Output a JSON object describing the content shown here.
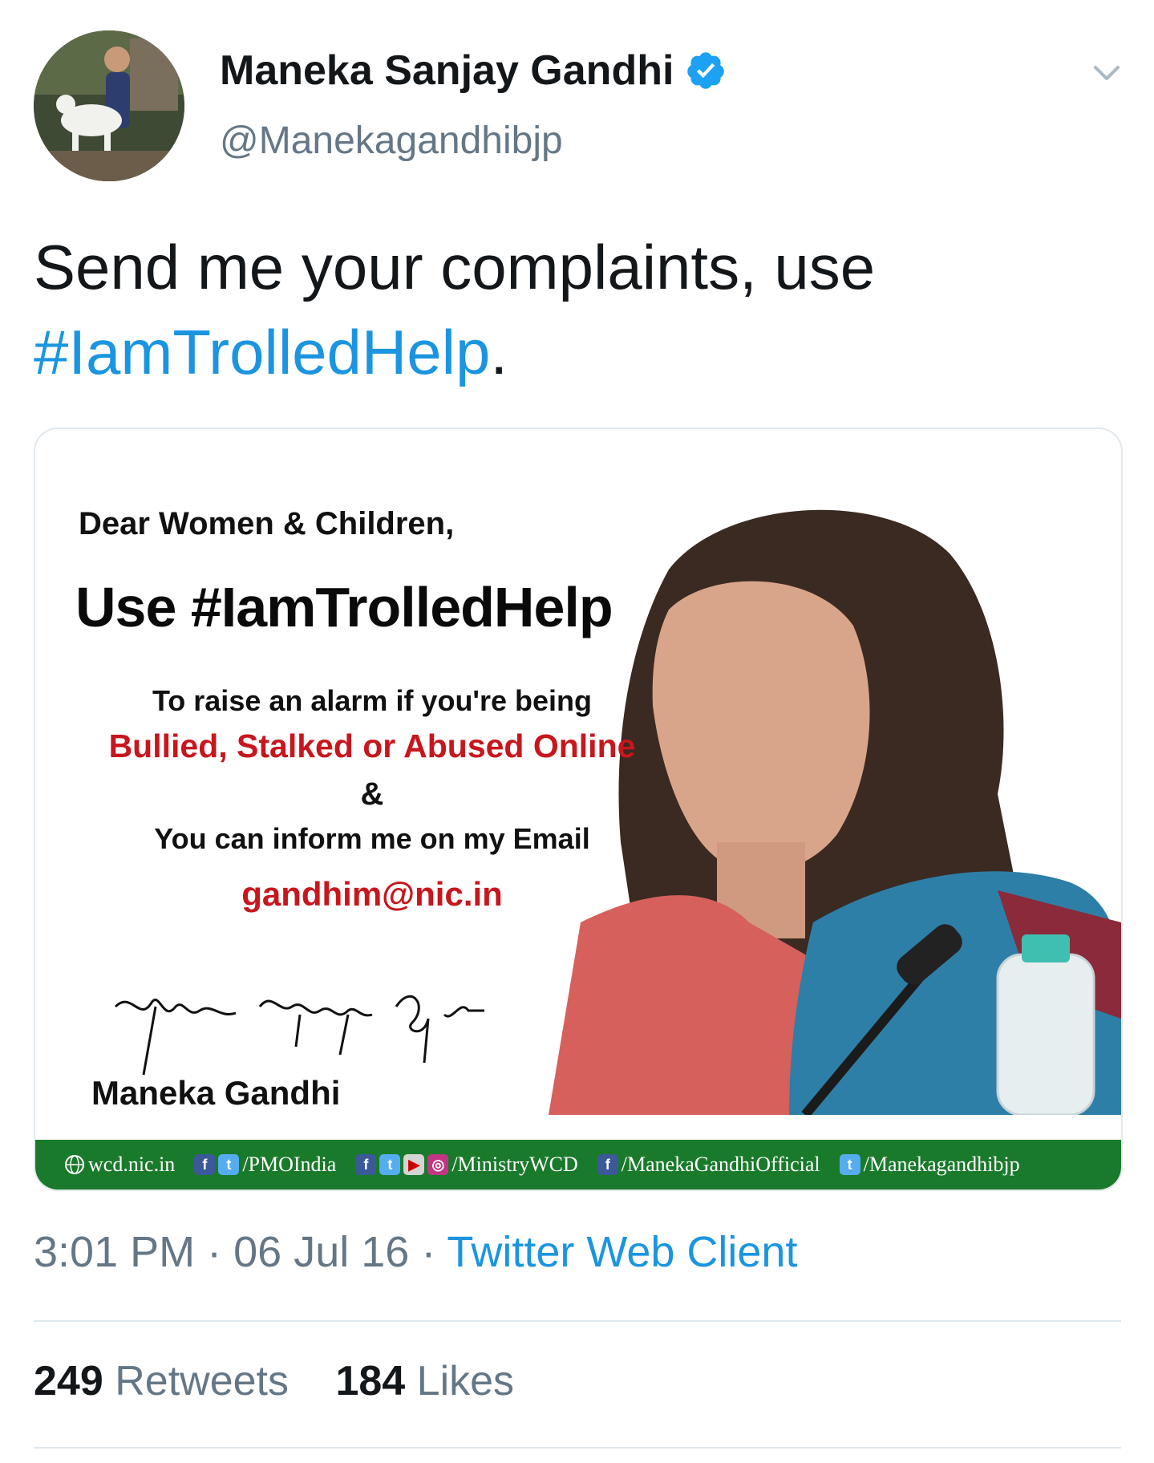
{
  "author": {
    "display_name": "Maneka Sanjay Gandhi",
    "handle": "@Manekagandhibjp",
    "verified": true
  },
  "tweet": {
    "text_prefix": "Send me your complaints, use",
    "hashtag": "#IamTrolledHelp",
    "text_suffix": "."
  },
  "card": {
    "greeting": "Dear Women & Children,",
    "headline": "Use #IamTrolledHelp",
    "line1": "To raise an alarm if you're being",
    "line2": "Bullied, Stalked or Abused Online",
    "line3": "&",
    "line4": "You can inform me on my Email",
    "email": "gandhim@nic.in",
    "signed_name": "Maneka Gandhi",
    "footer": {
      "site": "wcd.nic.in",
      "pmo": "/PMOIndia",
      "ministry": "/MinistryWCD",
      "official": "/ManekaGandhiOfficial",
      "twitter": "/Manekagandhibjp"
    }
  },
  "meta": {
    "time": "3:01 PM",
    "date": "06 Jul 16",
    "separator": "·",
    "source": "Twitter Web Client"
  },
  "stats": {
    "retweets_count": "249",
    "retweets_label": "Retweets",
    "likes_count": "184",
    "likes_label": "Likes"
  },
  "colors": {
    "link": "#1b95e0",
    "secondary_text": "#657786",
    "verified": "#1da1f2",
    "poster_red": "#c8161d",
    "poster_footer": "#1a7a2b"
  },
  "icons": [
    "verified-badge-icon",
    "chevron-down-icon",
    "globe-icon",
    "facebook-icon",
    "twitter-icon",
    "youtube-icon",
    "instagram-icon"
  ]
}
